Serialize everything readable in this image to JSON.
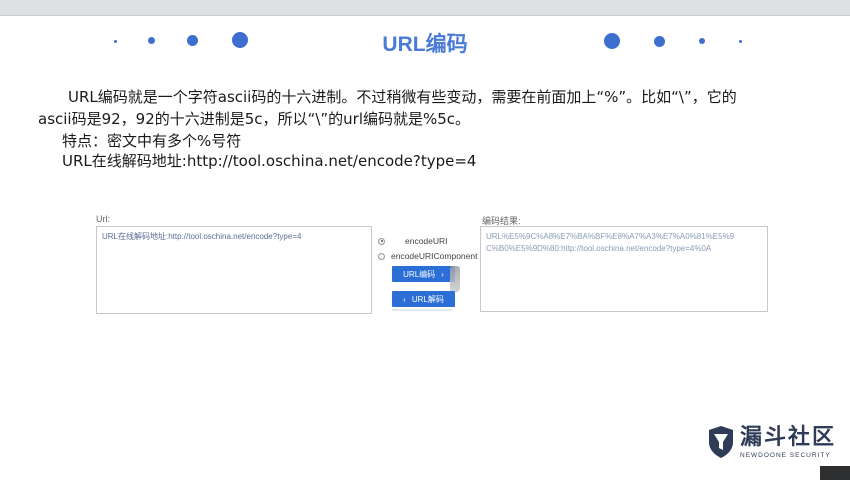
{
  "slide": {
    "title_en": "URL",
    "title_cn": "编码",
    "paragraph_line1": "URL编码就是一个字符ascii码的十六进制。不过稍微有些变动，需要在前面加上“%”。比如“\\”，它的",
    "paragraph_line2": "ascii码是92，92的十六进制是5c，所以“\\”的url编码就是%5c。",
    "feature": "特点：密文中有多个%号符",
    "online": "URL在线解码地址:http://tool.oschina.net/encode?type=4"
  },
  "tool": {
    "url_label": "Url:",
    "url_value": "URL在线解码地址:http://tool.oschina.net/encode?type=4",
    "result_label": "编码结果:",
    "result_line1": "URL%E5%9C%A8%E7%BA%BF%E8%A7%A3%E7%A0%81%E5%9",
    "result_line2": "C%B0%E5%9D%80:http://tool.oschina.net/encode?type=4%0A",
    "radio_encodeuri": "encodeURI",
    "radio_encodeuricomponent": "encodeURIComponent",
    "encode_button": "URL编码",
    "decode_button": "URL解码"
  },
  "logo": {
    "cn": "漏斗社区",
    "en": "NEWDOONE SECURITY"
  },
  "colors": {
    "accent": "#3d6fcf",
    "button": "#2b6fd6"
  }
}
